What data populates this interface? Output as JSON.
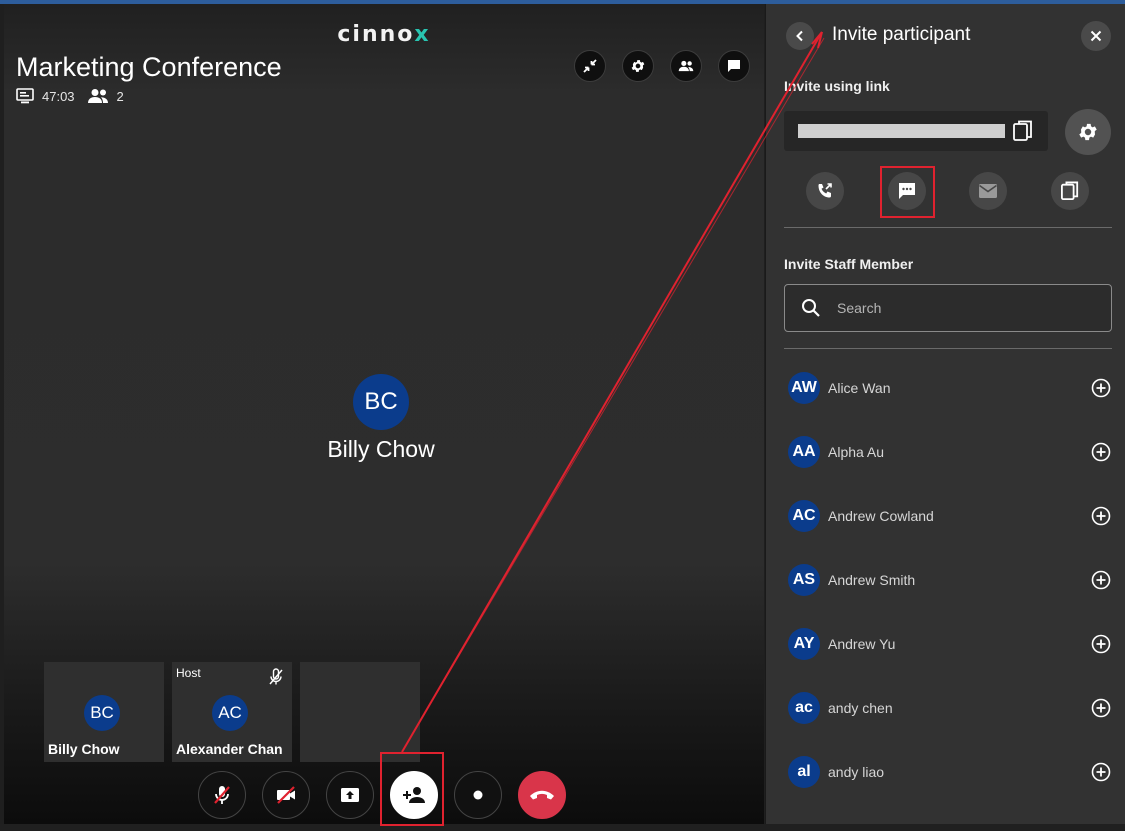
{
  "brand": {
    "main": "cinno",
    "accent": "x"
  },
  "conference": {
    "title": "Marketing Conference",
    "duration": "47:03",
    "participant_count": "2",
    "speaker": {
      "initials": "BC",
      "name": "Billy Chow"
    },
    "tiles": [
      {
        "initials": "BC",
        "name": "Billy Chow"
      },
      {
        "initials": "AC",
        "name": "Alexander Chan",
        "badge": "Host"
      }
    ]
  },
  "panel": {
    "title": "Invite participant",
    "invite_link_label": "Invite using link",
    "staff_label": "Invite Staff Member",
    "search_placeholder": "Search",
    "members": [
      {
        "initials": "AW",
        "name": "Alice Wan"
      },
      {
        "initials": "AA",
        "name": "Alpha Au"
      },
      {
        "initials": "AC",
        "name": "Andrew Cowland"
      },
      {
        "initials": "AS",
        "name": "Andrew Smith"
      },
      {
        "initials": "AY",
        "name": "Andrew Yu"
      },
      {
        "initials": "ac",
        "name": "andy chen"
      },
      {
        "initials": "al",
        "name": "andy liao"
      }
    ]
  },
  "colors": {
    "avatar": "#0b3c8c",
    "end_call": "#d9354a",
    "highlight": "#e0222f",
    "brand_accent": "#29c5b1"
  }
}
